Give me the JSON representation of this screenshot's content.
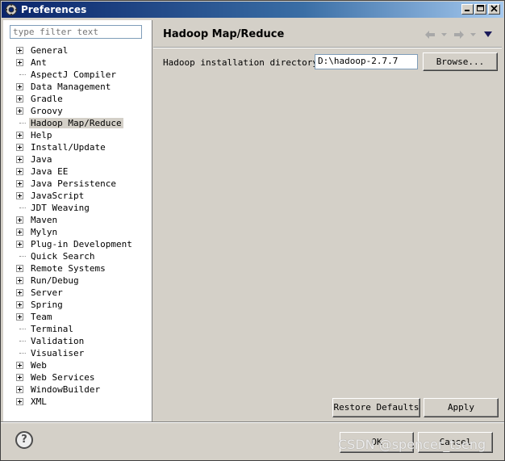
{
  "window": {
    "title": "Preferences"
  },
  "filter": {
    "placeholder": "type filter text"
  },
  "tree": {
    "items": [
      {
        "label": "General",
        "expandable": true
      },
      {
        "label": "Ant",
        "expandable": true
      },
      {
        "label": "AspectJ Compiler",
        "expandable": false
      },
      {
        "label": "Data Management",
        "expandable": true
      },
      {
        "label": "Gradle",
        "expandable": true
      },
      {
        "label": "Groovy",
        "expandable": true
      },
      {
        "label": "Hadoop Map/Reduce",
        "expandable": false,
        "selected": true
      },
      {
        "label": "Help",
        "expandable": true
      },
      {
        "label": "Install/Update",
        "expandable": true
      },
      {
        "label": "Java",
        "expandable": true
      },
      {
        "label": "Java EE",
        "expandable": true
      },
      {
        "label": "Java Persistence",
        "expandable": true
      },
      {
        "label": "JavaScript",
        "expandable": true
      },
      {
        "label": "JDT Weaving",
        "expandable": false
      },
      {
        "label": "Maven",
        "expandable": true
      },
      {
        "label": "Mylyn",
        "expandable": true
      },
      {
        "label": "Plug-in Development",
        "expandable": true
      },
      {
        "label": "Quick Search",
        "expandable": false
      },
      {
        "label": "Remote Systems",
        "expandable": true
      },
      {
        "label": "Run/Debug",
        "expandable": true
      },
      {
        "label": "Server",
        "expandable": true
      },
      {
        "label": "Spring",
        "expandable": true
      },
      {
        "label": "Team",
        "expandable": true
      },
      {
        "label": "Terminal",
        "expandable": false
      },
      {
        "label": "Validation",
        "expandable": false
      },
      {
        "label": "Visualiser",
        "expandable": false
      },
      {
        "label": "Web",
        "expandable": true
      },
      {
        "label": "Web Services",
        "expandable": true
      },
      {
        "label": "WindowBuilder",
        "expandable": true
      },
      {
        "label": "XML",
        "expandable": true
      }
    ]
  },
  "page": {
    "title": "Hadoop Map/Reduce",
    "install_dir_label": "Hadoop installation directory:",
    "install_dir_value": "D:\\hadoop-2.7.7",
    "browse_label": "Browse...",
    "restore_label": "Restore Defaults",
    "apply_label": "Apply"
  },
  "dialog": {
    "ok_label": "OK",
    "cancel_label": "Cancel",
    "help_symbol": "?"
  },
  "watermark": "CSDN @spencer_tseng"
}
